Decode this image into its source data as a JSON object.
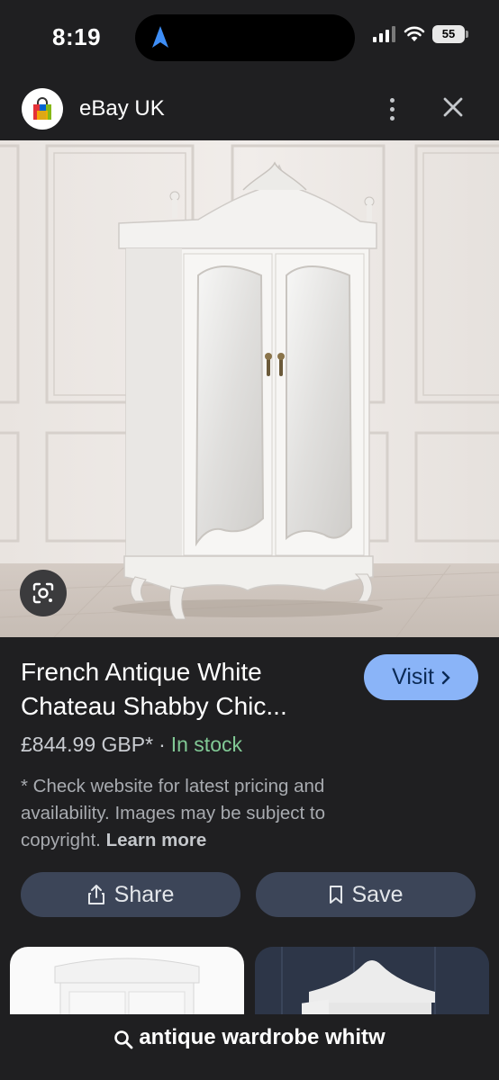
{
  "status_bar": {
    "time": "8:19",
    "battery": "55",
    "icons": [
      "navigation-arrow-icon",
      "signal-icon",
      "wifi-icon",
      "battery-icon"
    ]
  },
  "header": {
    "title": "eBay UK",
    "logo_icon": "shopping-bag-icon",
    "menu_icon": "more-vert-icon",
    "close_icon": "close-icon"
  },
  "product": {
    "image_description_icon": "wardrobe-image",
    "title": "French Antique White Chateau Shabby Chic...",
    "price": "£844.99 GBP*",
    "separator": "·",
    "stock": "In stock",
    "disclaimer": "* Check website for latest pricing and availability. Images may be subject to copyright.",
    "learn_more": "Learn more",
    "visit_label": "Visit",
    "share_label": "Share",
    "save_label": "Save"
  },
  "search": {
    "query": "antique wardrobe whitw",
    "icon": "search-icon"
  },
  "colors": {
    "background": "#1f1f21",
    "accent": "#8ab4f8",
    "stock_green": "#81c995",
    "button_bg": "#3c4558"
  }
}
